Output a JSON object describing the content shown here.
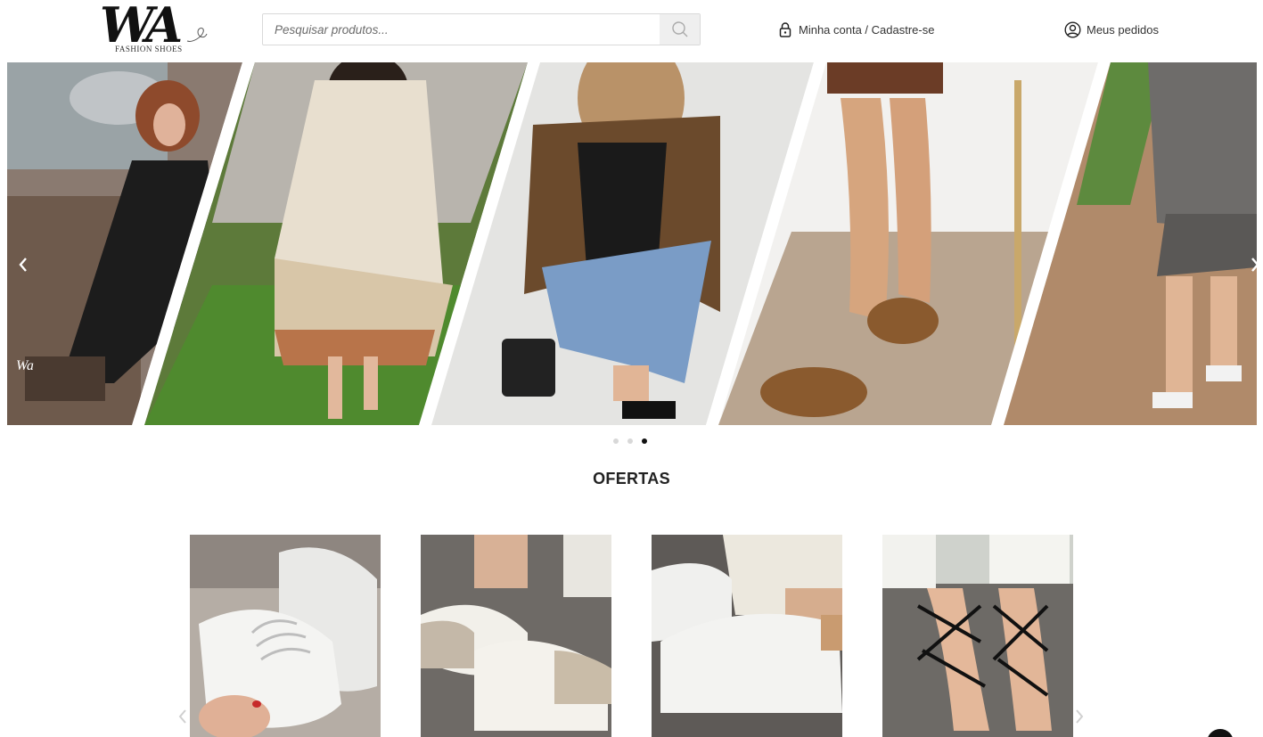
{
  "header": {
    "logo_text": "WA",
    "logo_subtitle": "FASHION SHOES",
    "search_placeholder": "Pesquisar produtos...",
    "search_icon": "search-icon",
    "account_icon": "lock-icon",
    "account_label": "Minha conta / Cadastre-se",
    "orders_icon": "user-circle-icon",
    "orders_label": "Meus pedidos"
  },
  "hero": {
    "prev_icon": "chevron-left-icon",
    "next_icon": "chevron-right-icon",
    "watermark": "Wa",
    "panels": [
      "woman-black-dress-umbrella",
      "woman-floral-dress-grass",
      "woman-leopard-jacket-jeans",
      "feet-gold-sandals",
      "woman-plaid-blazer-heels"
    ],
    "slides_count": 3,
    "active_slide": 3
  },
  "section": {
    "title": "OFERTAS"
  },
  "products": [
    {
      "image": "white-sneakers-in-hand"
    },
    {
      "image": "beige-white-sneakers-worn"
    },
    {
      "image": "white-sneakers-tan-detail"
    },
    {
      "image": "black-strappy-sandals"
    }
  ],
  "carousel": {
    "prev_icon": "chevron-left-icon",
    "next_icon": "chevron-right-icon"
  },
  "colors": {
    "accent": "#111111",
    "search_button_bg": "#efefef"
  }
}
